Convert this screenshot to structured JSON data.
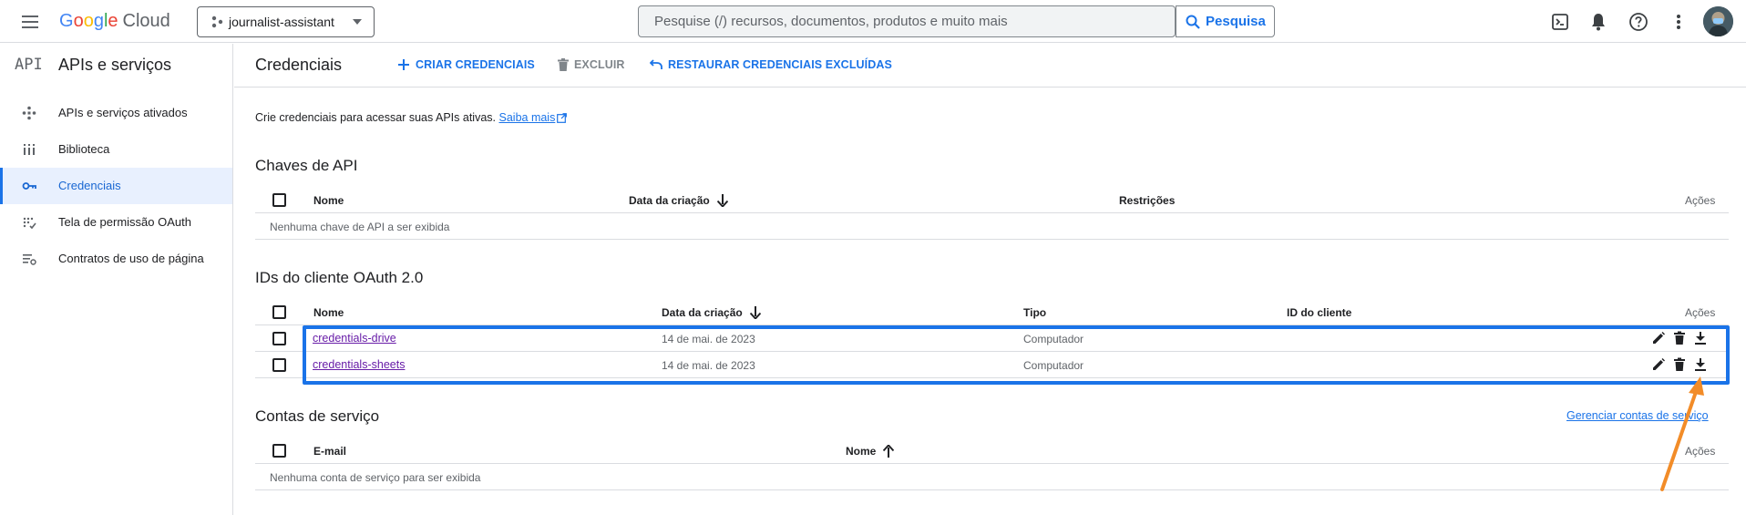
{
  "topbar": {
    "logo_google": [
      "G",
      "o",
      "o",
      "g",
      "l",
      "e"
    ],
    "logo_cloud": "Cloud",
    "project_name": "journalist-assistant",
    "search_placeholder": "Pesquise (/) recursos, documentos, produtos e muito mais",
    "search_button": "Pesquisa"
  },
  "sidebar": {
    "badge": "API",
    "title": "APIs e serviços",
    "items": [
      {
        "label": "APIs e serviços ativados",
        "icon": "enabled-apis-icon"
      },
      {
        "label": "Biblioteca",
        "icon": "library-icon"
      },
      {
        "label": "Credenciais",
        "icon": "key-icon",
        "active": true
      },
      {
        "label": "Tela de permissão OAuth",
        "icon": "oauth-consent-icon"
      },
      {
        "label": "Contratos de uso de página",
        "icon": "page-agreements-icon"
      }
    ]
  },
  "actionbar": {
    "title": "Credenciais",
    "create": "CRIAR CREDENCIAIS",
    "delete": "EXCLUIR",
    "restore": "RESTAURAR CREDENCIAIS EXCLUÍDAS"
  },
  "intro": {
    "text": "Crie credenciais para acessar suas APIs ativas.",
    "link": "Saiba mais"
  },
  "api_keys": {
    "title": "Chaves de API",
    "columns": [
      "Nome",
      "Data da criação",
      "Restrições",
      "Ações"
    ],
    "empty": "Nenhuma chave de API a ser exibida"
  },
  "oauth": {
    "title": "IDs do cliente OAuth 2.0",
    "columns": [
      "Nome",
      "Data da criação",
      "Tipo",
      "ID do cliente",
      "Ações"
    ],
    "rows": [
      {
        "name": "credentials-drive",
        "date": "14 de mai. de 2023",
        "type": "Computador",
        "client_id": ""
      },
      {
        "name": "credentials-sheets",
        "date": "14 de mai. de 2023",
        "type": "Computador",
        "client_id": ""
      }
    ]
  },
  "service_accounts": {
    "title": "Contas de serviço",
    "manage_link": "Gerenciar contas de serviço",
    "columns": [
      "E-mail",
      "Nome",
      "Ações"
    ],
    "empty": "Nenhuma conta de serviço para ser exibida"
  },
  "colors": {
    "accent": "#1a73e8",
    "highlight_box": "#1a73e8",
    "annotation_arrow": "#f28c28",
    "visited_link": "#681da8"
  }
}
